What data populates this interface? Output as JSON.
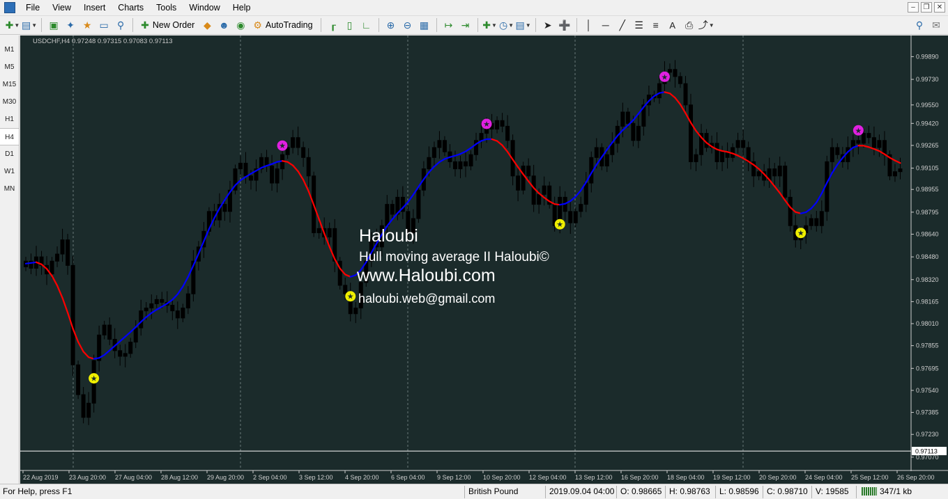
{
  "menu": {
    "items": [
      "File",
      "View",
      "Insert",
      "Charts",
      "Tools",
      "Window",
      "Help"
    ]
  },
  "window_controls": [
    "minimize-icon",
    "restore-icon",
    "close-icon"
  ],
  "toolbar": {
    "new_order_label": "New Order",
    "autotrading_label": "AutoTrading",
    "text_tool_label": "A"
  },
  "timeframes": {
    "items": [
      "M1",
      "M5",
      "M15",
      "M30",
      "H1",
      "H4",
      "D1",
      "W1",
      "MN"
    ],
    "active": "H4"
  },
  "chart": {
    "header": "USDCHF,H4  0.97248 0.97315 0.97083 0.97113",
    "current_price_label": "0.97113",
    "colors": {
      "background": "#1b2b2b",
      "up_candle": "#000000",
      "down_candle": "#000000",
      "hull_up": "#0000ff",
      "hull_down": "#ff0000",
      "top_marker": "#e020e0",
      "bottom_marker": "#f0f000",
      "price_line": "#ffffff"
    },
    "overlay": {
      "brand": "Haloubi",
      "indicator": "Hull moving average II Haloubi©",
      "website": "www.Haloubi.com",
      "email": "haloubi.web@gmail.com"
    }
  },
  "chart_data": {
    "type": "candlestick",
    "symbol": "USDCHF",
    "timeframe": "H4",
    "y_ticks": [
      "0.99890",
      "0.99730",
      "0.99550",
      "0.99420",
      "0.99265",
      "0.99105",
      "0.98955",
      "0.98795",
      "0.98640",
      "0.98480",
      "0.98320",
      "0.98165",
      "0.98010",
      "0.97855",
      "0.97695",
      "0.97540",
      "0.97385",
      "0.97230",
      "0.97070"
    ],
    "x_ticks": [
      "22 Aug 2019",
      "23 Aug 20:00",
      "27 Aug 04:00",
      "28 Aug 12:00",
      "29 Aug 20:00",
      "2 Sep 04:00",
      "3 Sep 12:00",
      "4 Sep 20:00",
      "6 Sep 04:00",
      "9 Sep 12:00",
      "10 Sep 20:00",
      "12 Sep 04:00",
      "13 Sep 12:00",
      "16 Sep 20:00",
      "18 Sep 04:00",
      "19 Sep 12:00",
      "20 Sep 20:00",
      "24 Sep 04:00",
      "25 Sep 12:00",
      "26 Sep 20:00"
    ],
    "ylim": [
      0.9703,
      0.9999
    ],
    "last_price": 0.97113,
    "ohlc_closes": [
      0.9845,
      0.984,
      0.9848,
      0.9842,
      0.9836,
      0.9845,
      0.985,
      0.986,
      0.9842,
      0.9772,
      0.9751,
      0.9735,
      0.9745,
      0.9775,
      0.9793,
      0.98,
      0.979,
      0.9782,
      0.9778,
      0.978,
      0.9788,
      0.9798,
      0.981,
      0.9812,
      0.9815,
      0.9818,
      0.9816,
      0.9814,
      0.981,
      0.9805,
      0.9812,
      0.9822,
      0.9845,
      0.9855,
      0.9866,
      0.988,
      0.9874,
      0.9885,
      0.988,
      0.9895,
      0.991,
      0.9914,
      0.9905,
      0.9902,
      0.991,
      0.9918,
      0.9912,
      0.99,
      0.991,
      0.992,
      0.9925,
      0.9932,
      0.9925,
      0.9918,
      0.9905,
      0.9865,
      0.9868,
      0.9862,
      0.9868,
      0.9845,
      0.9828,
      0.9822,
      0.9808,
      0.9812,
      0.983,
      0.9845,
      0.986,
      0.9855,
      0.987,
      0.9885,
      0.9878,
      0.989,
      0.988,
      0.9865,
      0.9875,
      0.9895,
      0.991,
      0.9918,
      0.9925,
      0.993,
      0.9922,
      0.9915,
      0.991,
      0.9915,
      0.9912,
      0.992,
      0.993,
      0.9935,
      0.9942,
      0.9938,
      0.9944,
      0.994,
      0.993,
      0.9905,
      0.9895,
      0.9912,
      0.9905,
      0.9885,
      0.9892,
      0.9898,
      0.9885,
      0.987,
      0.989,
      0.988,
      0.9872,
      0.988,
      0.9885,
      0.99,
      0.9918,
      0.9925,
      0.9912,
      0.992,
      0.9928,
      0.994,
      0.995,
      0.9942,
      0.993,
      0.994,
      0.9955,
      0.9962,
      0.996,
      0.997,
      0.9978,
      0.998,
      0.9975,
      0.997,
      0.9955,
      0.9915,
      0.992,
      0.9935,
      0.9925,
      0.9928,
      0.9915,
      0.9922,
      0.9918,
      0.9925,
      0.993,
      0.9925,
      0.9915,
      0.9905,
      0.9908,
      0.9902,
      0.991,
      0.9905,
      0.9912,
      0.989,
      0.987,
      0.986,
      0.9865,
      0.987,
      0.9875,
      0.987,
      0.988,
      0.9915,
      0.9925,
      0.992,
      0.9915,
      0.9925,
      0.993,
      0.9928,
      0.9935,
      0.9932,
      0.9925,
      0.993,
      0.992,
      0.9905,
      0.9908,
      0.991
    ],
    "hull_series_colors": [
      "up: blue",
      "down: red"
    ],
    "signals": [
      {
        "type": "top",
        "x_label": "23 Aug 20:00"
      },
      {
        "type": "bottom",
        "x_label": "27 Aug 04:00"
      },
      {
        "type": "top",
        "x_label": "3 Sep 12:00"
      },
      {
        "type": "bottom",
        "x_label": "6 Sep 04:00"
      },
      {
        "type": "top",
        "x_label": "12 Sep 04:00"
      },
      {
        "type": "bottom",
        "x_label": "13 Sep 12:00"
      },
      {
        "type": "top",
        "x_label": "18 Sep 04:00"
      },
      {
        "type": "bottom",
        "x_label": "25 Sep 12:00"
      }
    ]
  },
  "status": {
    "help": "For Help, press F1",
    "profile": "British Pound",
    "datetime": "2019.09.04 04:00",
    "open": "O: 0.98665",
    "high": "H: 0.98763",
    "low": "L: 0.98596",
    "close": "C: 0.98710",
    "volume": "V: 19585",
    "traffic": "347/1 kb"
  }
}
